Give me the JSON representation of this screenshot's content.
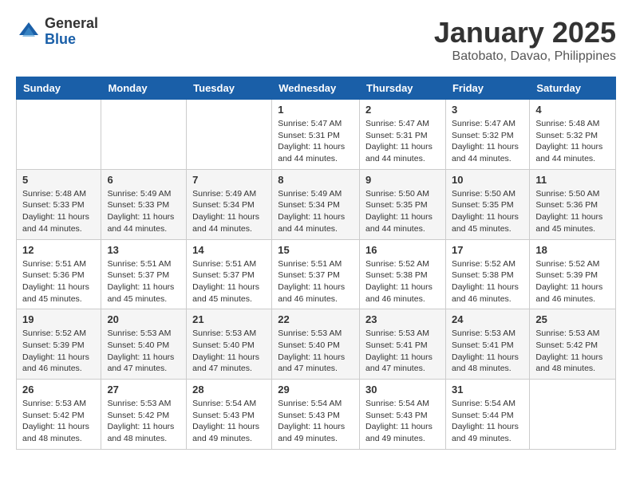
{
  "header": {
    "logo": {
      "general": "General",
      "blue": "Blue"
    },
    "title": "January 2025",
    "location": "Batobato, Davao, Philippines"
  },
  "weekdays": [
    "Sunday",
    "Monday",
    "Tuesday",
    "Wednesday",
    "Thursday",
    "Friday",
    "Saturday"
  ],
  "weeks": [
    [
      {
        "day": "",
        "info": ""
      },
      {
        "day": "",
        "info": ""
      },
      {
        "day": "",
        "info": ""
      },
      {
        "day": "1",
        "info": "Sunrise: 5:47 AM\nSunset: 5:31 PM\nDaylight: 11 hours and 44 minutes."
      },
      {
        "day": "2",
        "info": "Sunrise: 5:47 AM\nSunset: 5:31 PM\nDaylight: 11 hours and 44 minutes."
      },
      {
        "day": "3",
        "info": "Sunrise: 5:47 AM\nSunset: 5:32 PM\nDaylight: 11 hours and 44 minutes."
      },
      {
        "day": "4",
        "info": "Sunrise: 5:48 AM\nSunset: 5:32 PM\nDaylight: 11 hours and 44 minutes."
      }
    ],
    [
      {
        "day": "5",
        "info": "Sunrise: 5:48 AM\nSunset: 5:33 PM\nDaylight: 11 hours and 44 minutes."
      },
      {
        "day": "6",
        "info": "Sunrise: 5:49 AM\nSunset: 5:33 PM\nDaylight: 11 hours and 44 minutes."
      },
      {
        "day": "7",
        "info": "Sunrise: 5:49 AM\nSunset: 5:34 PM\nDaylight: 11 hours and 44 minutes."
      },
      {
        "day": "8",
        "info": "Sunrise: 5:49 AM\nSunset: 5:34 PM\nDaylight: 11 hours and 44 minutes."
      },
      {
        "day": "9",
        "info": "Sunrise: 5:50 AM\nSunset: 5:35 PM\nDaylight: 11 hours and 44 minutes."
      },
      {
        "day": "10",
        "info": "Sunrise: 5:50 AM\nSunset: 5:35 PM\nDaylight: 11 hours and 45 minutes."
      },
      {
        "day": "11",
        "info": "Sunrise: 5:50 AM\nSunset: 5:36 PM\nDaylight: 11 hours and 45 minutes."
      }
    ],
    [
      {
        "day": "12",
        "info": "Sunrise: 5:51 AM\nSunset: 5:36 PM\nDaylight: 11 hours and 45 minutes."
      },
      {
        "day": "13",
        "info": "Sunrise: 5:51 AM\nSunset: 5:37 PM\nDaylight: 11 hours and 45 minutes."
      },
      {
        "day": "14",
        "info": "Sunrise: 5:51 AM\nSunset: 5:37 PM\nDaylight: 11 hours and 45 minutes."
      },
      {
        "day": "15",
        "info": "Sunrise: 5:51 AM\nSunset: 5:37 PM\nDaylight: 11 hours and 46 minutes."
      },
      {
        "day": "16",
        "info": "Sunrise: 5:52 AM\nSunset: 5:38 PM\nDaylight: 11 hours and 46 minutes."
      },
      {
        "day": "17",
        "info": "Sunrise: 5:52 AM\nSunset: 5:38 PM\nDaylight: 11 hours and 46 minutes."
      },
      {
        "day": "18",
        "info": "Sunrise: 5:52 AM\nSunset: 5:39 PM\nDaylight: 11 hours and 46 minutes."
      }
    ],
    [
      {
        "day": "19",
        "info": "Sunrise: 5:52 AM\nSunset: 5:39 PM\nDaylight: 11 hours and 46 minutes."
      },
      {
        "day": "20",
        "info": "Sunrise: 5:53 AM\nSunset: 5:40 PM\nDaylight: 11 hours and 47 minutes."
      },
      {
        "day": "21",
        "info": "Sunrise: 5:53 AM\nSunset: 5:40 PM\nDaylight: 11 hours and 47 minutes."
      },
      {
        "day": "22",
        "info": "Sunrise: 5:53 AM\nSunset: 5:40 PM\nDaylight: 11 hours and 47 minutes."
      },
      {
        "day": "23",
        "info": "Sunrise: 5:53 AM\nSunset: 5:41 PM\nDaylight: 11 hours and 47 minutes."
      },
      {
        "day": "24",
        "info": "Sunrise: 5:53 AM\nSunset: 5:41 PM\nDaylight: 11 hours and 48 minutes."
      },
      {
        "day": "25",
        "info": "Sunrise: 5:53 AM\nSunset: 5:42 PM\nDaylight: 11 hours and 48 minutes."
      }
    ],
    [
      {
        "day": "26",
        "info": "Sunrise: 5:53 AM\nSunset: 5:42 PM\nDaylight: 11 hours and 48 minutes."
      },
      {
        "day": "27",
        "info": "Sunrise: 5:53 AM\nSunset: 5:42 PM\nDaylight: 11 hours and 48 minutes."
      },
      {
        "day": "28",
        "info": "Sunrise: 5:54 AM\nSunset: 5:43 PM\nDaylight: 11 hours and 49 minutes."
      },
      {
        "day": "29",
        "info": "Sunrise: 5:54 AM\nSunset: 5:43 PM\nDaylight: 11 hours and 49 minutes."
      },
      {
        "day": "30",
        "info": "Sunrise: 5:54 AM\nSunset: 5:43 PM\nDaylight: 11 hours and 49 minutes."
      },
      {
        "day": "31",
        "info": "Sunrise: 5:54 AM\nSunset: 5:44 PM\nDaylight: 11 hours and 49 minutes."
      },
      {
        "day": "",
        "info": ""
      }
    ]
  ]
}
